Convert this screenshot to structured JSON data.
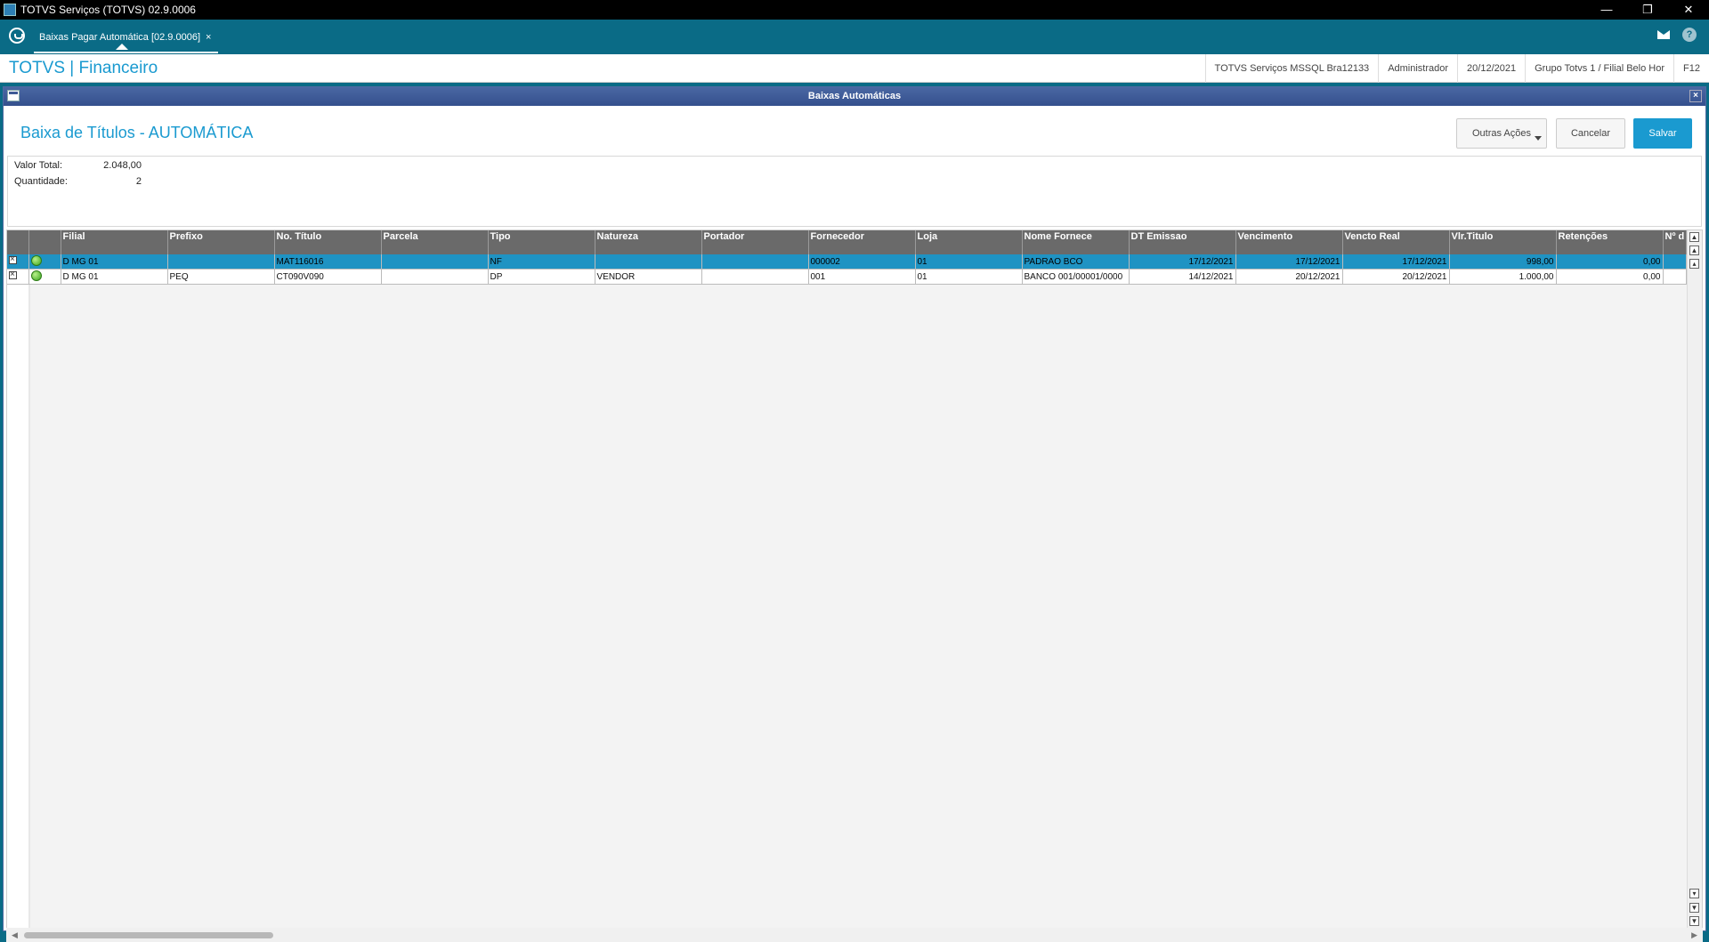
{
  "window": {
    "title": "TOTVS Serviços (TOTVS) 02.9.0006",
    "controls": [
      "—",
      "❐",
      "✕"
    ]
  },
  "tabbar": {
    "tab_label": "Baixas Pagar Automática [02.9.0006]",
    "tab_close": "×",
    "help": "?"
  },
  "header": {
    "brand": "TOTVS | Financeiro",
    "info": [
      "TOTVS Serviços MSSQL Bra12133",
      "Administrador",
      "20/12/2021",
      "Grupo Totvs 1 / Filial Belo Hor",
      "F12"
    ]
  },
  "dialog": {
    "title": "Baixas Automáticas",
    "close": "×",
    "page_title": "Baixa de Títulos - AUTOMÁTICA",
    "buttons": {
      "other_actions": "Outras Ações",
      "cancel": "Cancelar",
      "save": "Salvar"
    },
    "summary": {
      "total_label": "Valor Total:",
      "total_value": "2.048,00",
      "qty_label": "Quantidade:",
      "qty_value": "2"
    }
  },
  "grid": {
    "columns": [
      "Filial",
      "Prefixo",
      "No. Título",
      "Parcela",
      "Tipo",
      "Natureza",
      "Portador",
      "Fornecedor",
      "Loja",
      "Nome Fornece",
      "DT Emissao",
      "Vencimento",
      "Vencto Real",
      "Vlr.Titulo",
      "Retenções",
      "Nº d"
    ],
    "rows": [
      {
        "selected": true,
        "status": "green",
        "cells": [
          "D MG 01",
          "",
          "MAT116016",
          "",
          "NF",
          "",
          "",
          "000002",
          "01",
          "PADRAO BCO",
          "17/12/2021",
          "17/12/2021",
          "17/12/2021",
          "998,00",
          "0,00",
          ""
        ]
      },
      {
        "selected": false,
        "status": "green",
        "cells": [
          "D MG 01",
          "PEQ",
          "CT090V090",
          "",
          "DP",
          "VENDOR",
          "",
          "001",
          "01",
          "BANCO 001/00001/0000",
          "14/12/2021",
          "20/12/2021",
          "20/12/2021",
          "1.000,00",
          "0,00",
          ""
        ]
      }
    ]
  },
  "colors": {
    "accent": "#1a9ad0",
    "tabbar": "#0a6b86",
    "dialog_title": "#3e5a96",
    "selected_row": "#1f93c3"
  }
}
